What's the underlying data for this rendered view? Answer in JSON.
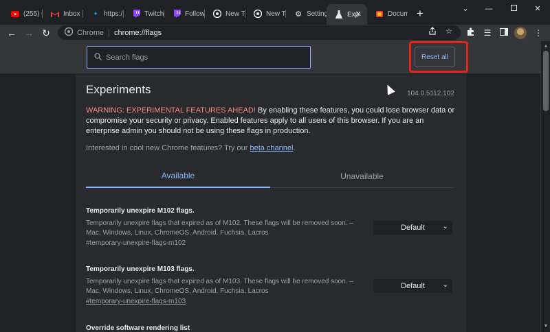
{
  "tabs": [
    {
      "title": "(255) C",
      "icon": "youtube-icon",
      "color": "#ff0000"
    },
    {
      "title": "Inbox (",
      "icon": "gmail-icon",
      "color": "#ea4335"
    },
    {
      "title": "https:/",
      "icon": "twitter-icon",
      "color": "#1d9bf0"
    },
    {
      "title": "Twitch",
      "icon": "twitch-icon",
      "color": "#9146ff"
    },
    {
      "title": "Follow",
      "icon": "twitch-icon",
      "color": "#9146ff"
    },
    {
      "title": "New Ta",
      "icon": "chrome-icon",
      "color": "#e8eaed"
    },
    {
      "title": "New Ta",
      "icon": "chrome-icon",
      "color": "#e8eaed"
    },
    {
      "title": "Setting",
      "icon": "gear-icon",
      "color": "#e8eaed"
    },
    {
      "title": "Exp",
      "icon": "flask-icon",
      "color": "#e8eaed"
    },
    {
      "title": "Docum",
      "icon": "docs-icon",
      "color": "#ea4335"
    }
  ],
  "omnibox": {
    "site": "Chrome",
    "path": "chrome://flags"
  },
  "search": {
    "placeholder": "Search flags"
  },
  "reset_label": "Reset all",
  "page": {
    "title": "Experiments",
    "version": "104.0.5112.102",
    "warning_red": "WARNING: EXPERIMENTAL FEATURES AHEAD!",
    "warning_rest": " By enabling these features, you could lose browser data or compromise your security or privacy. Enabled features apply to all users of this browser. If you are an enterprise admin you should not be using these flags in production.",
    "interest_text": "Interested in cool new Chrome features? Try our ",
    "interest_link": "beta channel",
    "interest_end": "."
  },
  "tab_labels": {
    "available": "Available",
    "unavailable": "Unavailable"
  },
  "flags": [
    {
      "name": "Temporarily unexpire M102 flags.",
      "description": "Temporarily unexpire flags that expired as of M102. These flags will be removed soon. –",
      "platforms": "Mac, Windows, Linux, ChromeOS, Android, Fuchsia, Lacros",
      "anchor": "#temporary-unexpire-flags-m102",
      "value": "Default"
    },
    {
      "name": "Temporarily unexpire M103 flags.",
      "description": "Temporarily unexpire flags that expired as of M103. These flags will be removed soon. –",
      "platforms": "Mac, Windows, Linux, ChromeOS, Android, Fuchsia, Lacros",
      "anchor": "#temporary-unexpire-flags-m103",
      "value": "Default"
    }
  ],
  "next_flag_name": "Override software rendering list",
  "colors": {
    "accent": "#8ab4f8",
    "warning": "#f28b82",
    "highlight": "#e0251c"
  }
}
